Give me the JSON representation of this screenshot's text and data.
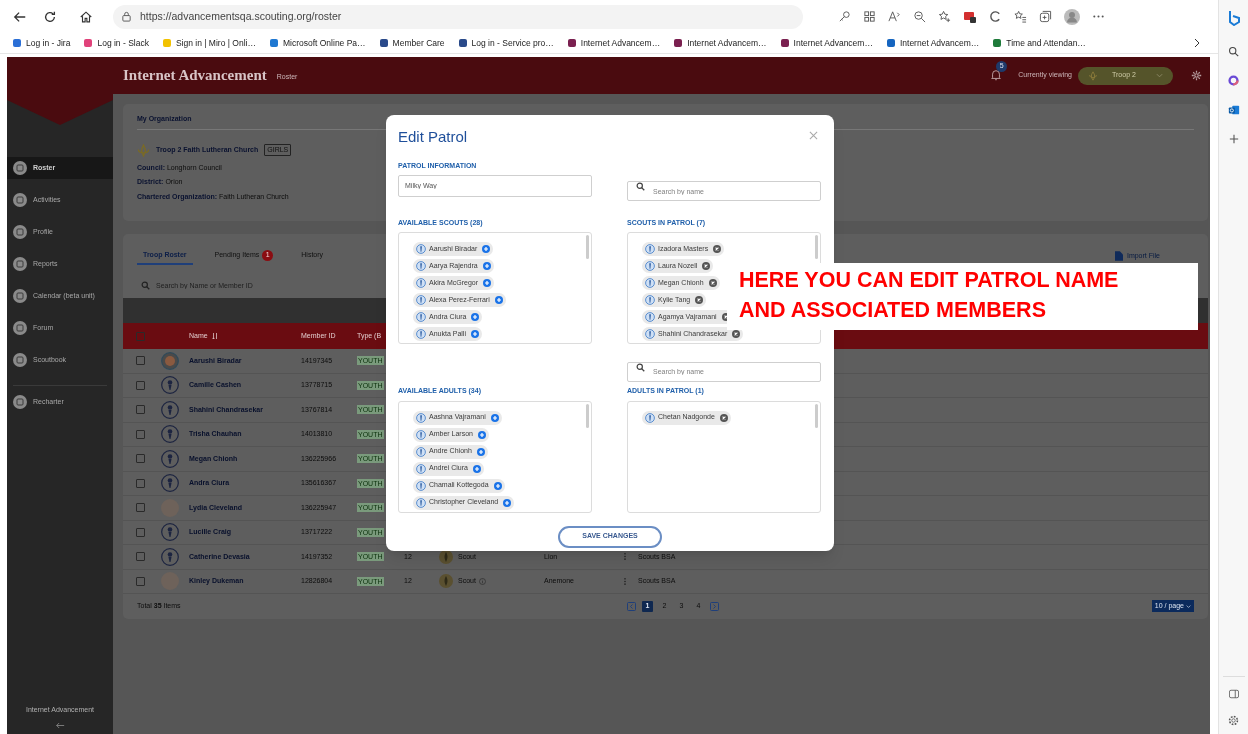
{
  "browser": {
    "url": "https://advancementsqa.scouting.org/roster",
    "bookmarks": [
      {
        "label": "Log in - Jira"
      },
      {
        "label": "Log in - Slack"
      },
      {
        "label": "Sign in | Miro | Onli…"
      },
      {
        "label": "Microsoft Online Pa…"
      },
      {
        "label": "Member Care"
      },
      {
        "label": "Log in - Service pro…"
      },
      {
        "label": "Internet Advancem…"
      },
      {
        "label": "Internet Advancem…"
      },
      {
        "label": "Internet Advancem…"
      },
      {
        "label": "Internet Advancem…"
      },
      {
        "label": "Time and Attendan…"
      }
    ]
  },
  "app": {
    "title": "Internet Advancement",
    "page": "Roster",
    "notifications": "5",
    "viewing_label": "Currently viewing",
    "unit": "Troop 2"
  },
  "sidebar": {
    "items": [
      {
        "label": "Roster",
        "selected": true
      },
      {
        "label": "Activities",
        "selected": false
      },
      {
        "label": "Profile",
        "selected": false
      },
      {
        "label": "Reports",
        "selected": false
      },
      {
        "label": "Calendar (beta unit)",
        "selected": false
      },
      {
        "label": "Forum",
        "selected": false
      },
      {
        "label": "Scoutbook",
        "selected": false
      }
    ],
    "bottom_items": [
      {
        "label": "Recharter",
        "selected": false
      }
    ],
    "footer": "Internet Advancement"
  },
  "organization": {
    "heading": "My Organization",
    "unit_name": "Troop 2 Faith Lutheran Church",
    "unit_tag": "GIRLS",
    "details": [
      {
        "label": "Council:",
        "value": "Longhorn Council"
      },
      {
        "label": "District:",
        "value": "Orion"
      },
      {
        "label": "Chartered Organization:",
        "value": "Faith Lutheran Church"
      }
    ]
  },
  "roster": {
    "tabs": [
      {
        "label": "Troop Roster",
        "selected": true
      },
      {
        "label": "Pending Items",
        "selected": false,
        "badge": "1"
      },
      {
        "label": "History",
        "selected": false
      }
    ],
    "import_label": "Import File",
    "search": {
      "placeholder": "Search by Name or Member ID"
    },
    "table": {
      "all_checked": false,
      "columns": [
        "Name",
        "Member ID",
        "Type (B"
      ],
      "rows": [
        {
          "name": "Aarushi Biradar",
          "member_id": "14197345",
          "type": "YOUTH",
          "kind": "badge",
          "checked": false
        },
        {
          "name": "Camille Cashen",
          "member_id": "13778715",
          "type": "YOUTH",
          "kind": "silhouette",
          "checked": false
        },
        {
          "name": "Shahini Chandrasekar",
          "member_id": "13767814",
          "type": "YOUTH",
          "kind": "silhouette",
          "checked": false
        },
        {
          "name": "Trisha Chauhan",
          "member_id": "14013810",
          "type": "YOUTH",
          "kind": "silhouette",
          "checked": false
        },
        {
          "name": "Megan Chionh",
          "member_id": "136225966",
          "type": "YOUTH",
          "kind": "silhouette",
          "checked": false
        },
        {
          "name": "Andra Ciura",
          "member_id": "135616367",
          "type": "YOUTH",
          "kind": "silhouette",
          "checked": false
        },
        {
          "name": "Lydia Cleveland",
          "member_id": "136225947",
          "type": "YOUTH",
          "kind": "photo",
          "checked": false
        },
        {
          "name": "Lucille Craig",
          "member_id": "13717222",
          "type": "YOUTH",
          "kind": "silhouette",
          "checked": false
        },
        {
          "name": "Catherine Devasia",
          "member_id": "14197352",
          "type": "YOUTH",
          "kind": "silhouette",
          "checked": false,
          "age": "12",
          "rank": "Scout",
          "rank_info": false,
          "patrol": "Lion",
          "program": "Scouts BSA"
        },
        {
          "name": "Kinley Dukeman",
          "member_id": "12826804",
          "type": "YOUTH",
          "kind": "photo",
          "checked": false,
          "age": "12",
          "rank": "Scout",
          "rank_info": true,
          "patrol": "Anemone",
          "program": "Scouts BSA"
        }
      ]
    },
    "total": "Total **35** Items",
    "pages": [
      {
        "label": "1",
        "selected": true
      },
      {
        "label": "2",
        "selected": false
      },
      {
        "label": "3",
        "selected": false
      },
      {
        "label": "4",
        "selected": false
      }
    ],
    "page_size": "10 / page"
  },
  "modal": {
    "title": "Edit Patrol",
    "name_label": "PATROL INFORMATION",
    "name_value": "Milky Way",
    "save_label": "SAVE CHANGES",
    "sections": [
      {
        "search_placeholder": "Search by name",
        "available_label": "AVAILABLE SCOUTS (28)",
        "member_label": "SCOUTS IN PATROL (7)",
        "available": [
          "Aarushi Biradar",
          "Aarya Rajendra",
          "Akira McGregor",
          "Alexa Perez-Ferrari",
          "Andra Ciura",
          "Anukta Palli"
        ],
        "members": [
          "Izadora Masters",
          "Laura Nozell",
          "Megan Chionh",
          "Kylie Tang",
          "Agamya Vajramani",
          "Shahini Chandrasekar"
        ]
      },
      {
        "search_placeholder": "Search by name",
        "available_label": "AVAILABLE ADULTS (34)",
        "member_label": "ADULTS IN PATROL (1)",
        "available": [
          "Aashna Vajramani",
          "Amber Larson",
          "Andre Chionh",
          "Andrei Ciura",
          "Chamali Kottegoda",
          "Christopher Cleveland"
        ],
        "members": [
          "Chetan Nadgonde"
        ]
      }
    ]
  },
  "annotation": {
    "lines": [
      "HERE YOU CAN EDIT PATROL NAME",
      "AND ASSOCIATED MEMBERS"
    ]
  }
}
